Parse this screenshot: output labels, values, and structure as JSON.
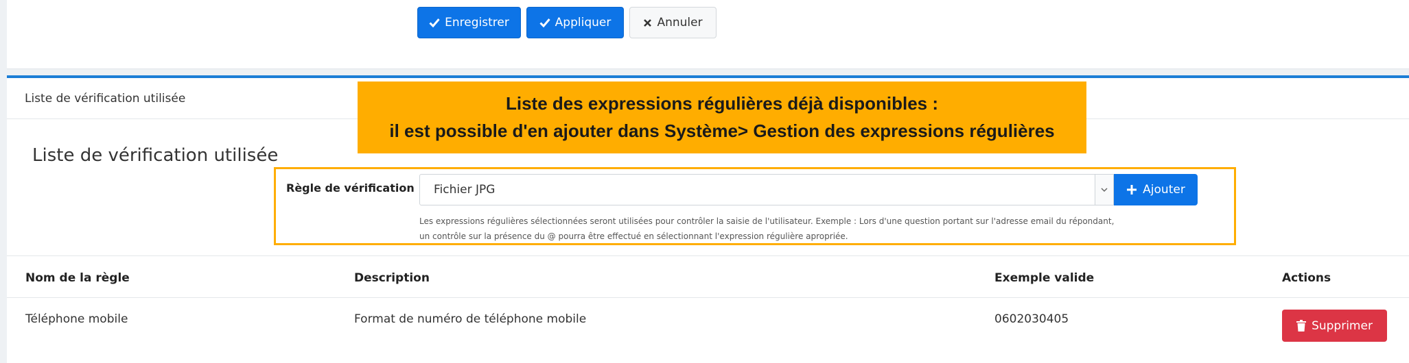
{
  "toolbar": {
    "save_label": "Enregistrer",
    "apply_label": "Appliquer",
    "cancel_label": "Annuler",
    "save_icon": "check-icon",
    "apply_icon": "check-icon",
    "cancel_icon": "close-icon"
  },
  "card": {
    "header_title": "Liste de vérification utilisée",
    "section_title": "Liste de vérification utilisée"
  },
  "annotation": {
    "line1": "Liste des expressions régulières déjà disponibles :",
    "line2": "il est possible d'en ajouter dans Système> Gestion des expressions régulières",
    "color": "#ffad00"
  },
  "rule_form": {
    "label": "Règle de vérification",
    "selected_value": "Fichier JPG",
    "add_label": "Ajouter",
    "add_icon": "plus-icon",
    "help_line1": "Les expressions régulières sélectionnées seront utilisées pour contrôler la saisie de l'utilisateur. Exemple : Lors d'une question portant sur l'adresse email du répondant,",
    "help_line2": "un contrôle sur la présence du @ pourra être effectué en sélectionnant l'expression régulière apropriée."
  },
  "table": {
    "columns": [
      "Nom de la règle",
      "Description",
      "Exemple valide",
      "Actions"
    ],
    "rows": [
      {
        "name": "Téléphone mobile",
        "description": "Format de numéro de téléphone mobile",
        "example": "0602030405",
        "action_label": "Supprimer",
        "action_icon": "trash-icon"
      }
    ]
  },
  "colors": {
    "primary": "#0d74e7",
    "danger": "#dc3545",
    "accent_border": "#1c7ed6",
    "highlight": "#ffad00"
  }
}
